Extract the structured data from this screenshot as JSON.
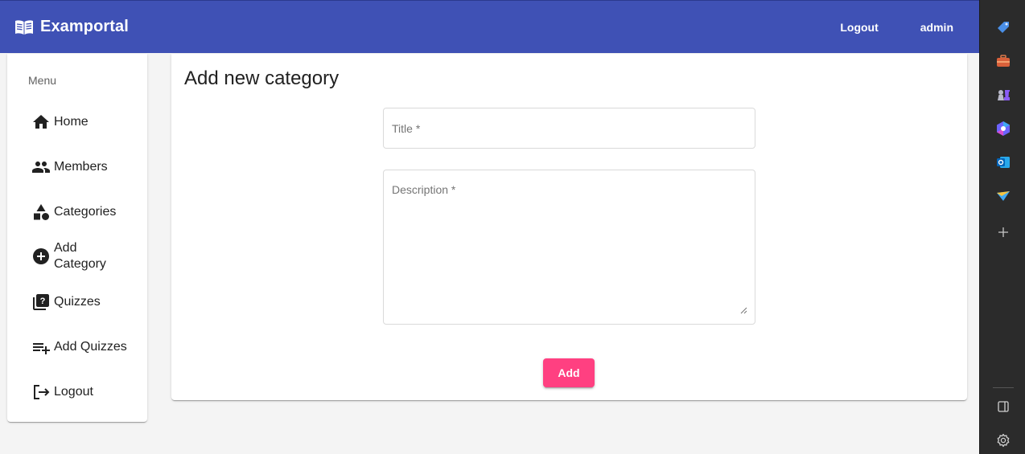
{
  "toolbar": {
    "brand_title": "Examportal",
    "brand_icon": "book-open-icon",
    "logout_label": "Logout",
    "user_label": "admin",
    "background_color": "#3f51b5"
  },
  "sidebar": {
    "header": "Menu",
    "items": [
      {
        "label": "Home",
        "icon": "home-icon"
      },
      {
        "label": "Members",
        "icon": "people-icon"
      },
      {
        "label": "Categories",
        "icon": "category-shapes-icon"
      },
      {
        "label": "Add Category",
        "icon": "add-circle-icon"
      },
      {
        "label": "Quizzes",
        "icon": "quiz-icon"
      },
      {
        "label": "Add Quizzes",
        "icon": "playlist-add-icon"
      },
      {
        "label": "Logout",
        "icon": "logout-icon"
      }
    ]
  },
  "main": {
    "title": "Add new category",
    "title_field": {
      "placeholder": "Title *",
      "value": ""
    },
    "description_field": {
      "placeholder": "Description *",
      "value": ""
    },
    "add_label": "Add",
    "accent_color": "#ff4081"
  },
  "side_panel": {
    "icons": [
      "tag-icon",
      "toolbox-icon",
      "chess-icon",
      "copilot-icon",
      "outlook-icon",
      "send-icon",
      "plus-icon",
      "sidebar-toggle-icon",
      "settings-gear-icon"
    ]
  }
}
